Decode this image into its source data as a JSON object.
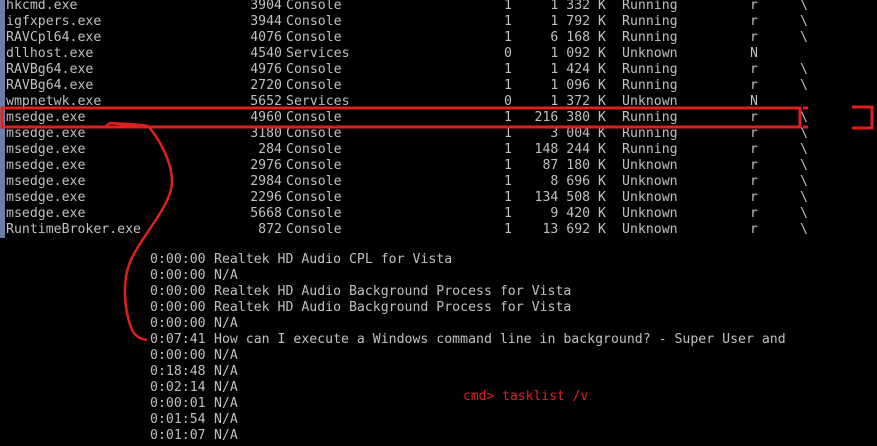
{
  "processes": [
    {
      "name": "hkcmd.exe",
      "pid": "3904",
      "session": "Console",
      "num": "1",
      "mem": "1 332 K",
      "status": "Running",
      "user": "r",
      "tick": "\\"
    },
    {
      "name": "igfxpers.exe",
      "pid": "3944",
      "session": "Console",
      "num": "1",
      "mem": "1 792 K",
      "status": "Running",
      "user": "r",
      "tick": "\\"
    },
    {
      "name": "RAVCpl64.exe",
      "pid": "4076",
      "session": "Console",
      "num": "1",
      "mem": "6 168 K",
      "status": "Running",
      "user": "r",
      "tick": "\\"
    },
    {
      "name": "dllhost.exe",
      "pid": "4540",
      "session": "Services",
      "num": "0",
      "mem": "1 092 K",
      "status": "Unknown",
      "user": "N",
      "tick": ""
    },
    {
      "name": "RAVBg64.exe",
      "pid": "4976",
      "session": "Console",
      "num": "1",
      "mem": "1 424 K",
      "status": "Running",
      "user": "r",
      "tick": "\\"
    },
    {
      "name": "RAVBg64.exe",
      "pid": "2720",
      "session": "Console",
      "num": "1",
      "mem": "1 096 K",
      "status": "Running",
      "user": "r",
      "tick": "\\"
    },
    {
      "name": "wmpnetwk.exe",
      "pid": "5652",
      "session": "Services",
      "num": "0",
      "mem": "1 372 K",
      "status": "Unknown",
      "user": "N",
      "tick": ""
    },
    {
      "name": "msedge.exe",
      "pid": "4960",
      "session": "Console",
      "num": "1",
      "mem": "216 380 K",
      "status": "Running",
      "user": "r",
      "tick": "\\"
    },
    {
      "name": "msedge.exe",
      "pid": "3180",
      "session": "Console",
      "num": "1",
      "mem": "3 004 K",
      "status": "Running",
      "user": "r",
      "tick": "\\"
    },
    {
      "name": "msedge.exe",
      "pid": "284",
      "session": "Console",
      "num": "1",
      "mem": "148 244 K",
      "status": "Running",
      "user": "r",
      "tick": "\\"
    },
    {
      "name": "msedge.exe",
      "pid": "2976",
      "session": "Console",
      "num": "1",
      "mem": "87 180 K",
      "status": "Unknown",
      "user": "r",
      "tick": "\\"
    },
    {
      "name": "msedge.exe",
      "pid": "2984",
      "session": "Console",
      "num": "1",
      "mem": "8 696 K",
      "status": "Unknown",
      "user": "r",
      "tick": "\\"
    },
    {
      "name": "msedge.exe",
      "pid": "2296",
      "session": "Console",
      "num": "1",
      "mem": "134 508 K",
      "status": "Unknown",
      "user": "r",
      "tick": "\\"
    },
    {
      "name": "msedge.exe",
      "pid": "5668",
      "session": "Console",
      "num": "1",
      "mem": "9 420 K",
      "status": "Unknown",
      "user": "r",
      "tick": "\\"
    },
    {
      "name": "RuntimeBroker.exe",
      "pid": "872",
      "session": "Console",
      "num": "1",
      "mem": "13 692 K",
      "status": "Unknown",
      "user": "r",
      "tick": "\\"
    }
  ],
  "window_rows": [
    {
      "time": "0:00:00",
      "title": "Realtek HD Audio CPL for Vista"
    },
    {
      "time": "0:00:00",
      "title": "N/A"
    },
    {
      "time": "0:00:00",
      "title": "Realtek HD Audio Background Process for Vista"
    },
    {
      "time": "0:00:00",
      "title": "Realtek HD Audio Background Process for Vista"
    },
    {
      "time": "0:00:00",
      "title": "N/A"
    },
    {
      "time": "0:07:41",
      "title": "How can I execute a Windows command line in background? - Super User and"
    },
    {
      "time": "0:00:00",
      "title": "N/A"
    },
    {
      "time": "0:18:48",
      "title": "N/A"
    },
    {
      "time": "0:02:14",
      "title": "N/A"
    },
    {
      "time": "0:00:01",
      "title": "N/A"
    },
    {
      "time": "0:01:54",
      "title": "N/A"
    },
    {
      "time": "0:01:07",
      "title": "N/A"
    }
  ],
  "annotation": {
    "command_note": "cmd> tasklist /v",
    "highlight_color": "#e0201d"
  },
  "colors": {
    "background": "#000000",
    "text": "#c0c0c0",
    "selection_bar": "#6b7fa8"
  }
}
